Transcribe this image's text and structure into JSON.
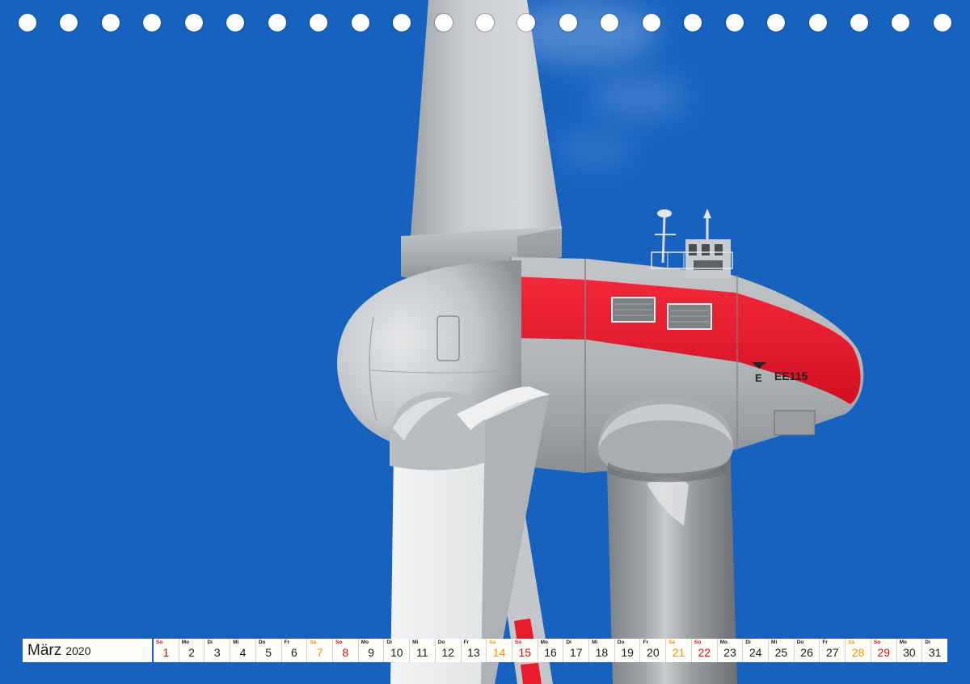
{
  "colors": {
    "sky": "#1762bf",
    "nacelle_stripe": "#e8152a",
    "sunday": "#e30613",
    "saturday": "#f39200",
    "weekday": "#1a1a1a"
  },
  "nacelle": {
    "logo_text": "E",
    "model_label": "EE115"
  },
  "calendar": {
    "month": "März",
    "year": "2020",
    "days": [
      {
        "weekday": "So",
        "day": 1
      },
      {
        "weekday": "Mo",
        "day": 2
      },
      {
        "weekday": "Di",
        "day": 3
      },
      {
        "weekday": "Mi",
        "day": 4
      },
      {
        "weekday": "Do",
        "day": 5
      },
      {
        "weekday": "Fr",
        "day": 6
      },
      {
        "weekday": "Sa",
        "day": 7
      },
      {
        "weekday": "So",
        "day": 8
      },
      {
        "weekday": "Mo",
        "day": 9
      },
      {
        "weekday": "Di",
        "day": 10
      },
      {
        "weekday": "Mi",
        "day": 11
      },
      {
        "weekday": "Do",
        "day": 12
      },
      {
        "weekday": "Fr",
        "day": 13
      },
      {
        "weekday": "Sa",
        "day": 14
      },
      {
        "weekday": "So",
        "day": 15
      },
      {
        "weekday": "Mo",
        "day": 16
      },
      {
        "weekday": "Di",
        "day": 17
      },
      {
        "weekday": "Mi",
        "day": 18
      },
      {
        "weekday": "Do",
        "day": 19
      },
      {
        "weekday": "Fr",
        "day": 20
      },
      {
        "weekday": "Sa",
        "day": 21
      },
      {
        "weekday": "So",
        "day": 22
      },
      {
        "weekday": "Mo",
        "day": 23
      },
      {
        "weekday": "Di",
        "day": 24
      },
      {
        "weekday": "Mi",
        "day": 25
      },
      {
        "weekday": "Do",
        "day": 26
      },
      {
        "weekday": "Fr",
        "day": 27
      },
      {
        "weekday": "Sa",
        "day": 28
      },
      {
        "weekday": "So",
        "day": 29
      },
      {
        "weekday": "Mo",
        "day": 30
      },
      {
        "weekday": "Di",
        "day": 31
      }
    ]
  }
}
